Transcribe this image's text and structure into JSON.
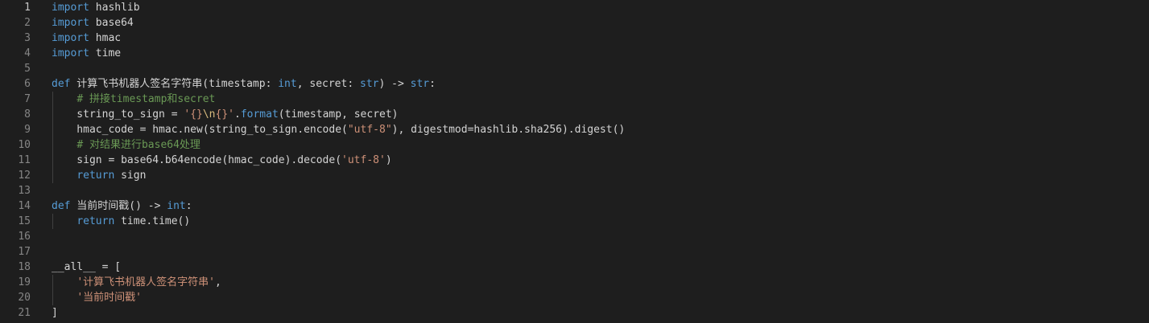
{
  "editor": {
    "language": "python",
    "colors": {
      "background": "#1e1e1e",
      "line_number": "#858585",
      "active_line_number": "#c6c6c6",
      "keyword": "#569cd6",
      "comment": "#6a9955",
      "string": "#ce9178",
      "default_text": "#d4d4d4"
    },
    "active_line": 1,
    "lines": [
      {
        "n": "1",
        "guide": false,
        "tokens": [
          {
            "t": "kw",
            "v": "import"
          },
          {
            "t": "id",
            "v": " hashlib"
          }
        ]
      },
      {
        "n": "2",
        "guide": false,
        "tokens": [
          {
            "t": "kw",
            "v": "import"
          },
          {
            "t": "id",
            "v": " base64"
          }
        ]
      },
      {
        "n": "3",
        "guide": false,
        "tokens": [
          {
            "t": "kw",
            "v": "import"
          },
          {
            "t": "id",
            "v": " hmac"
          }
        ]
      },
      {
        "n": "4",
        "guide": false,
        "tokens": [
          {
            "t": "kw",
            "v": "import"
          },
          {
            "t": "id",
            "v": " time"
          }
        ]
      },
      {
        "n": "5",
        "guide": false,
        "tokens": []
      },
      {
        "n": "6",
        "guide": false,
        "tokens": [
          {
            "t": "kw",
            "v": "def"
          },
          {
            "t": "id",
            "v": " 计算飞书机器人签名字符串(timestamp: "
          },
          {
            "t": "kw",
            "v": "int"
          },
          {
            "t": "id",
            "v": ", secret: "
          },
          {
            "t": "kw",
            "v": "str"
          },
          {
            "t": "id",
            "v": ") -> "
          },
          {
            "t": "kw",
            "v": "str"
          },
          {
            "t": "id",
            "v": ":"
          }
        ]
      },
      {
        "n": "7",
        "guide": true,
        "tokens": [
          {
            "t": "id",
            "v": "    "
          },
          {
            "t": "cm",
            "v": "# 拼接timestamp和secret"
          }
        ]
      },
      {
        "n": "8",
        "guide": true,
        "tokens": [
          {
            "t": "id",
            "v": "    string_to_sign = "
          },
          {
            "t": "str",
            "v": "'{}"
          },
          {
            "t": "esc",
            "v": "\\n"
          },
          {
            "t": "str",
            "v": "{}'"
          },
          {
            "t": "id",
            "v": "."
          },
          {
            "t": "kw",
            "v": "format"
          },
          {
            "t": "id",
            "v": "(timestamp, secret)"
          }
        ]
      },
      {
        "n": "9",
        "guide": true,
        "tokens": [
          {
            "t": "id",
            "v": "    hmac_code = hmac.new(string_to_sign.encode("
          },
          {
            "t": "str",
            "v": "\"utf-8\""
          },
          {
            "t": "id",
            "v": "), digestmod=hashlib.sha256).digest()"
          }
        ]
      },
      {
        "n": "10",
        "guide": true,
        "tokens": [
          {
            "t": "id",
            "v": "    "
          },
          {
            "t": "cm",
            "v": "# 对结果进行base64处理"
          }
        ]
      },
      {
        "n": "11",
        "guide": true,
        "tokens": [
          {
            "t": "id",
            "v": "    sign = base64.b64encode(hmac_code).decode("
          },
          {
            "t": "str",
            "v": "'utf-8'"
          },
          {
            "t": "id",
            "v": ")"
          }
        ]
      },
      {
        "n": "12",
        "guide": true,
        "tokens": [
          {
            "t": "id",
            "v": "    "
          },
          {
            "t": "kw",
            "v": "return"
          },
          {
            "t": "id",
            "v": " sign"
          }
        ]
      },
      {
        "n": "13",
        "guide": false,
        "tokens": []
      },
      {
        "n": "14",
        "guide": false,
        "tokens": [
          {
            "t": "kw",
            "v": "def"
          },
          {
            "t": "id",
            "v": " 当前时间戳() -> "
          },
          {
            "t": "kw",
            "v": "int"
          },
          {
            "t": "id",
            "v": ":"
          }
        ]
      },
      {
        "n": "15",
        "guide": true,
        "tokens": [
          {
            "t": "id",
            "v": "    "
          },
          {
            "t": "kw",
            "v": "return"
          },
          {
            "t": "id",
            "v": " time.time()"
          }
        ]
      },
      {
        "n": "16",
        "guide": false,
        "tokens": []
      },
      {
        "n": "17",
        "guide": false,
        "tokens": []
      },
      {
        "n": "18",
        "guide": false,
        "tokens": [
          {
            "t": "id",
            "v": "__all__ = ["
          }
        ]
      },
      {
        "n": "19",
        "guide": true,
        "tokens": [
          {
            "t": "id",
            "v": "    "
          },
          {
            "t": "str",
            "v": "'计算飞书机器人签名字符串'"
          },
          {
            "t": "id",
            "v": ","
          }
        ]
      },
      {
        "n": "20",
        "guide": true,
        "tokens": [
          {
            "t": "id",
            "v": "    "
          },
          {
            "t": "str",
            "v": "'当前时间戳'"
          }
        ]
      },
      {
        "n": "21",
        "guide": false,
        "tokens": [
          {
            "t": "id",
            "v": "]"
          }
        ]
      }
    ]
  }
}
